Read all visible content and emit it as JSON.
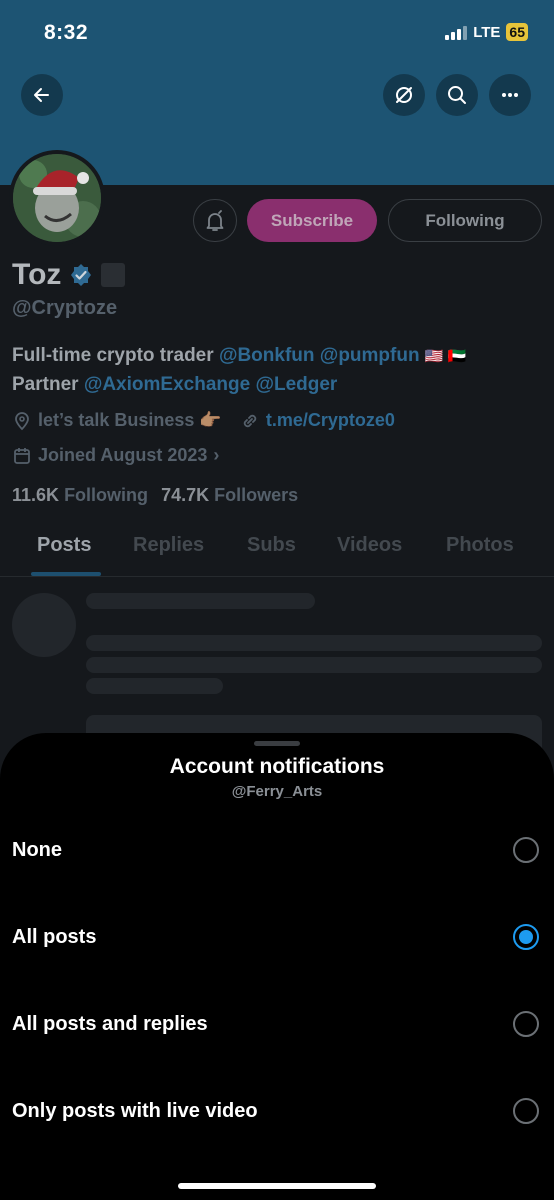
{
  "status_bar": {
    "time": "8:32",
    "network": "LTE",
    "battery": "65"
  },
  "header": {
    "icons": [
      "back-arrow-icon",
      "no-sync-icon",
      "search-icon",
      "more-icon"
    ]
  },
  "profile": {
    "name": "Toz",
    "handle": "@Cryptoze",
    "subscribe_label": "Subscribe",
    "following_button_label": "Following",
    "bio_line1_text": "Full-time crypto trader",
    "bio_mention1": "@Bonkfun",
    "bio_mention2": "@pumpfun",
    "bio_flags": "🇺🇸 🇦🇪",
    "bio_line2_text": "Partner",
    "bio_mention3": "@AxiomExchange",
    "bio_mention4": "@Ledger",
    "location": "let’s talk Business 👉🏽",
    "website": "t.me/Cryptoze0",
    "joined": "Joined August 2023",
    "following_count": "11.6K",
    "following_label": "Following",
    "followers_count": "74.7K",
    "followers_label": "Followers",
    "tabs": [
      "Posts",
      "Replies",
      "Subs",
      "Videos",
      "Photos"
    ]
  },
  "sheet": {
    "title": "Account notifications",
    "subtitle": "@Ferry_Arts",
    "options": [
      {
        "label": "None",
        "selected": false
      },
      {
        "label": "All posts",
        "selected": true
      },
      {
        "label": "All posts and replies",
        "selected": false
      },
      {
        "label": "Only posts with live video",
        "selected": false
      }
    ]
  },
  "colors": {
    "accent": "#1d9bf0",
    "banner": "#1d5473",
    "subscribe": "#8a2f6e"
  }
}
